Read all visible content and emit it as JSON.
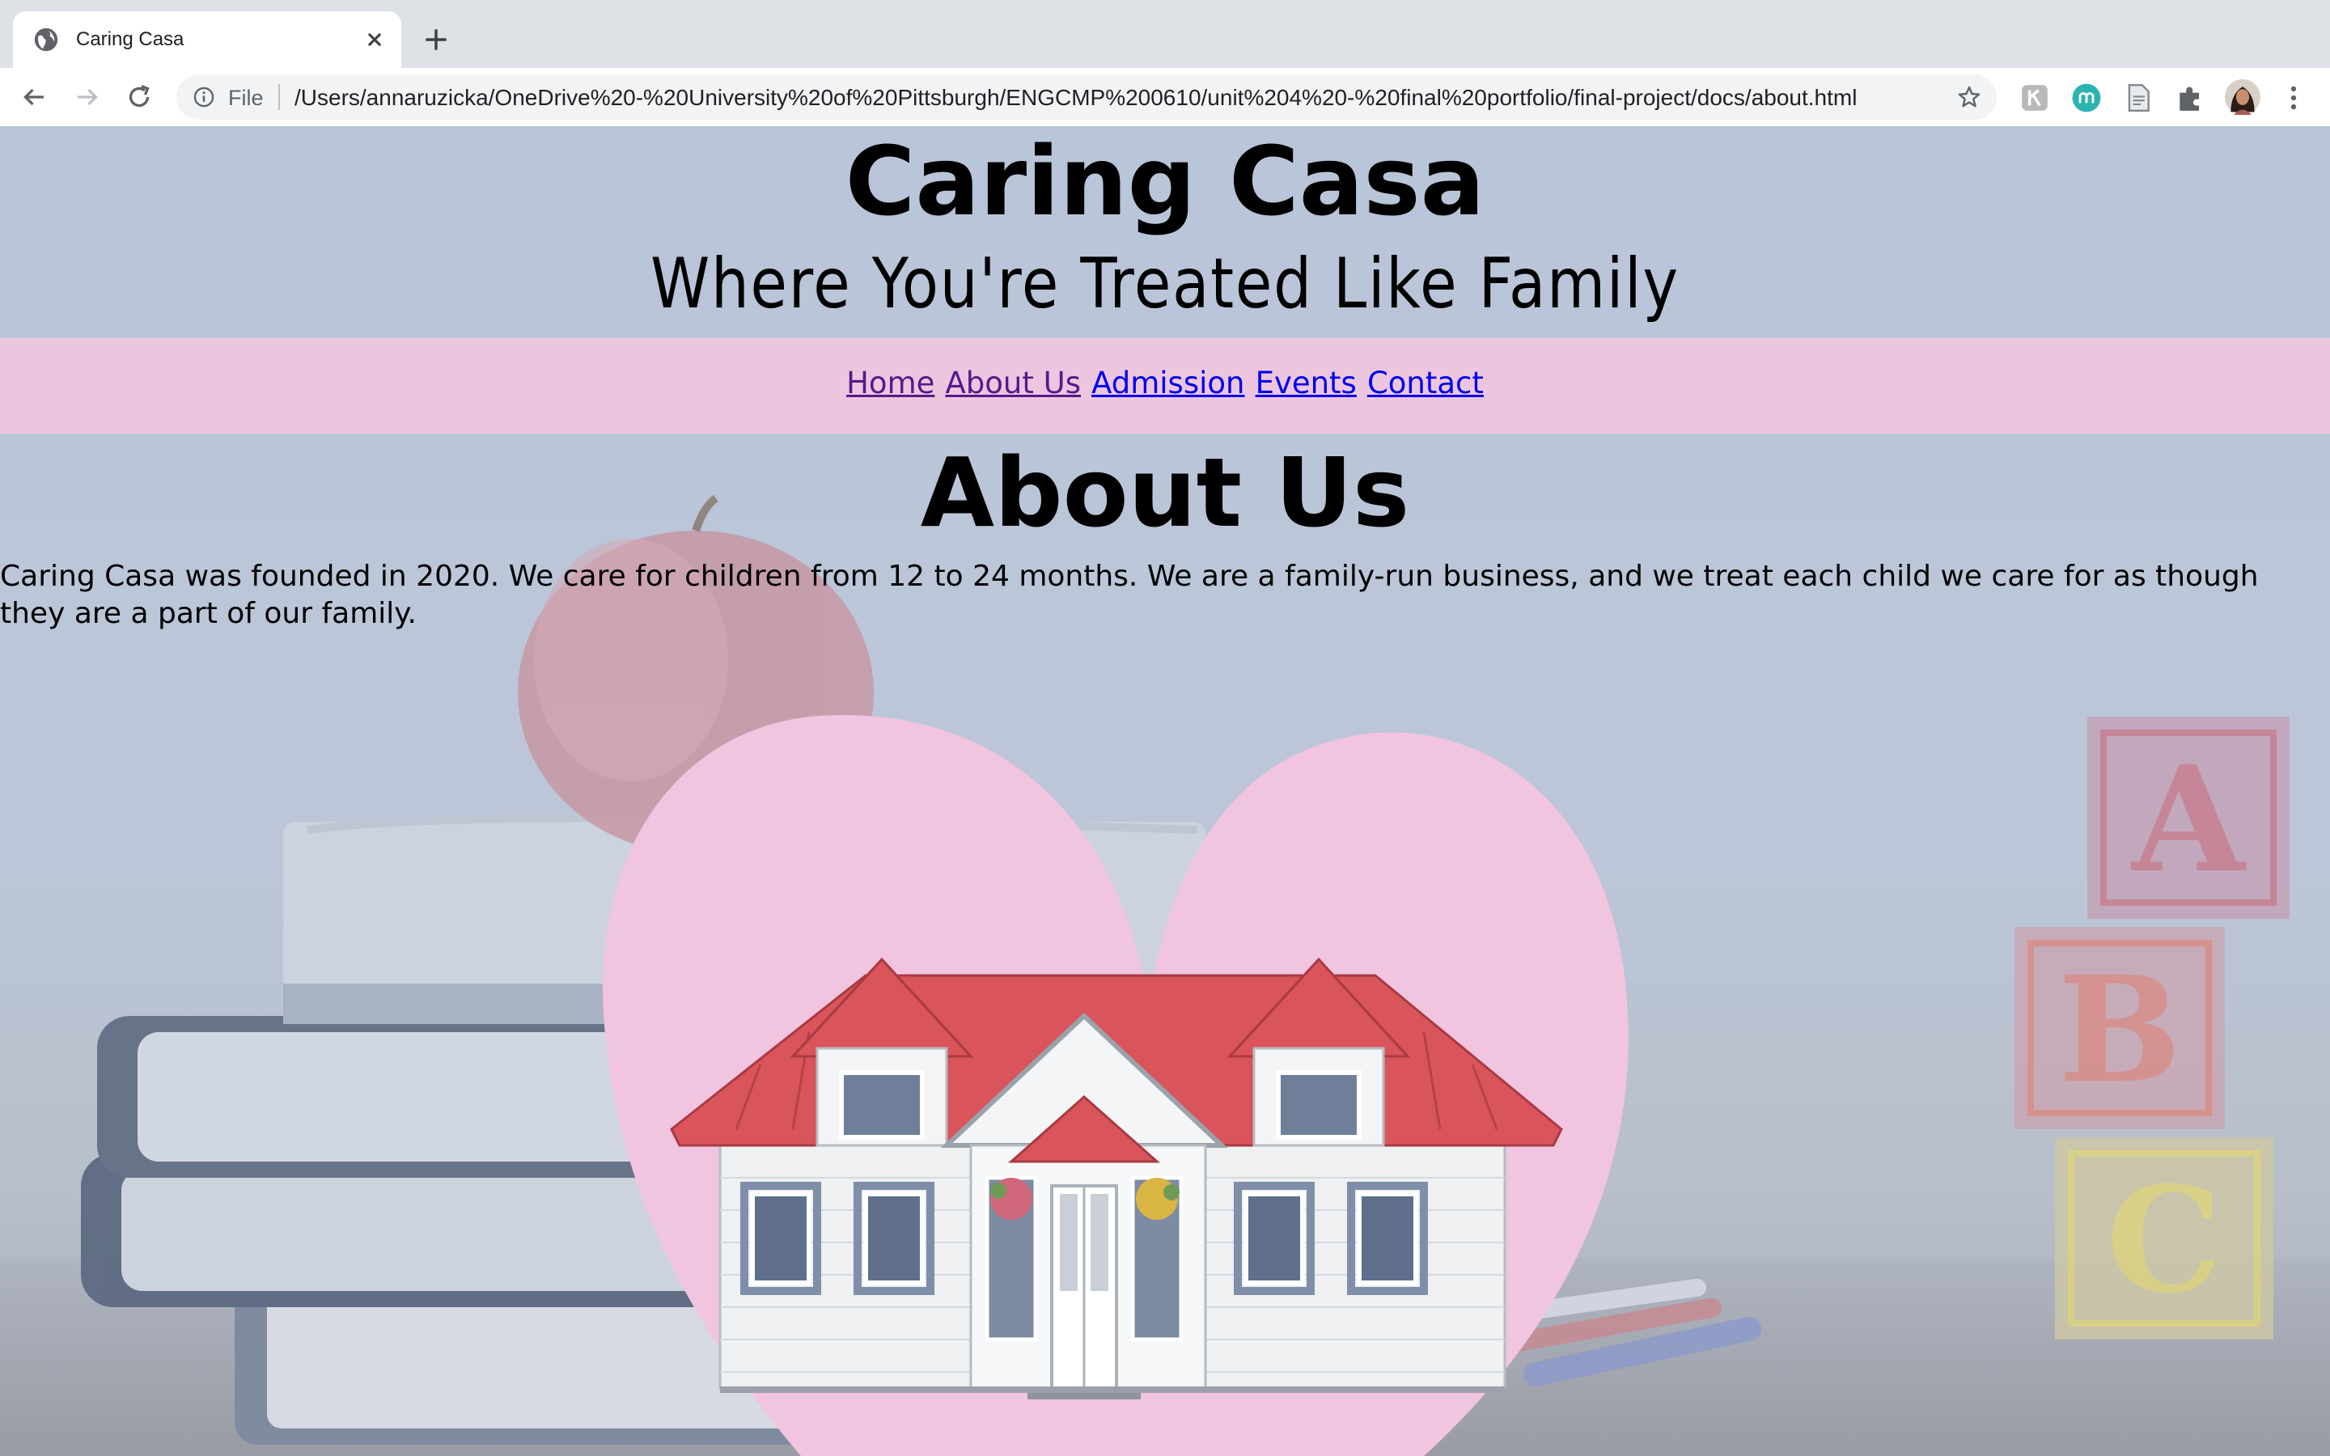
{
  "browser": {
    "tab_title": "Caring Casa",
    "omnibox_scheme": "File",
    "url": "/Users/annaruzicka/OneDrive%20-%20University%20of%20Pittsburgh/ENGCMP%200610/unit%204%20-%20final%20portfolio/final-project/docs/about.html",
    "extensions": [
      "grammar-extension-icon",
      "m-extension-icon",
      "document-extension-icon",
      "puzzle-extensions-icon",
      "profile-avatar",
      "kebab-menu-icon"
    ]
  },
  "site": {
    "title": "Caring Casa",
    "tagline": "Where You're Treated Like Family"
  },
  "nav": {
    "items": [
      {
        "label": "Home",
        "state": "visited"
      },
      {
        "label": "About Us",
        "state": "visited"
      },
      {
        "label": "Admission",
        "state": "unvisited"
      },
      {
        "label": "Events",
        "state": "unvisited"
      },
      {
        "label": "Contact",
        "state": "unvisited"
      }
    ]
  },
  "main": {
    "heading": "About Us",
    "body": "Caring Casa was founded in 2020. We care for children from 12 to 24 months. We are a family-run business, and we treat each child we care for as though they are a part of our family."
  },
  "colors": {
    "nav_bar": "#ecc6df",
    "heart": "#f1c4e0",
    "visited_link": "#551a8b",
    "unvisited_link": "#0000ee",
    "roof": "#d9545b"
  }
}
